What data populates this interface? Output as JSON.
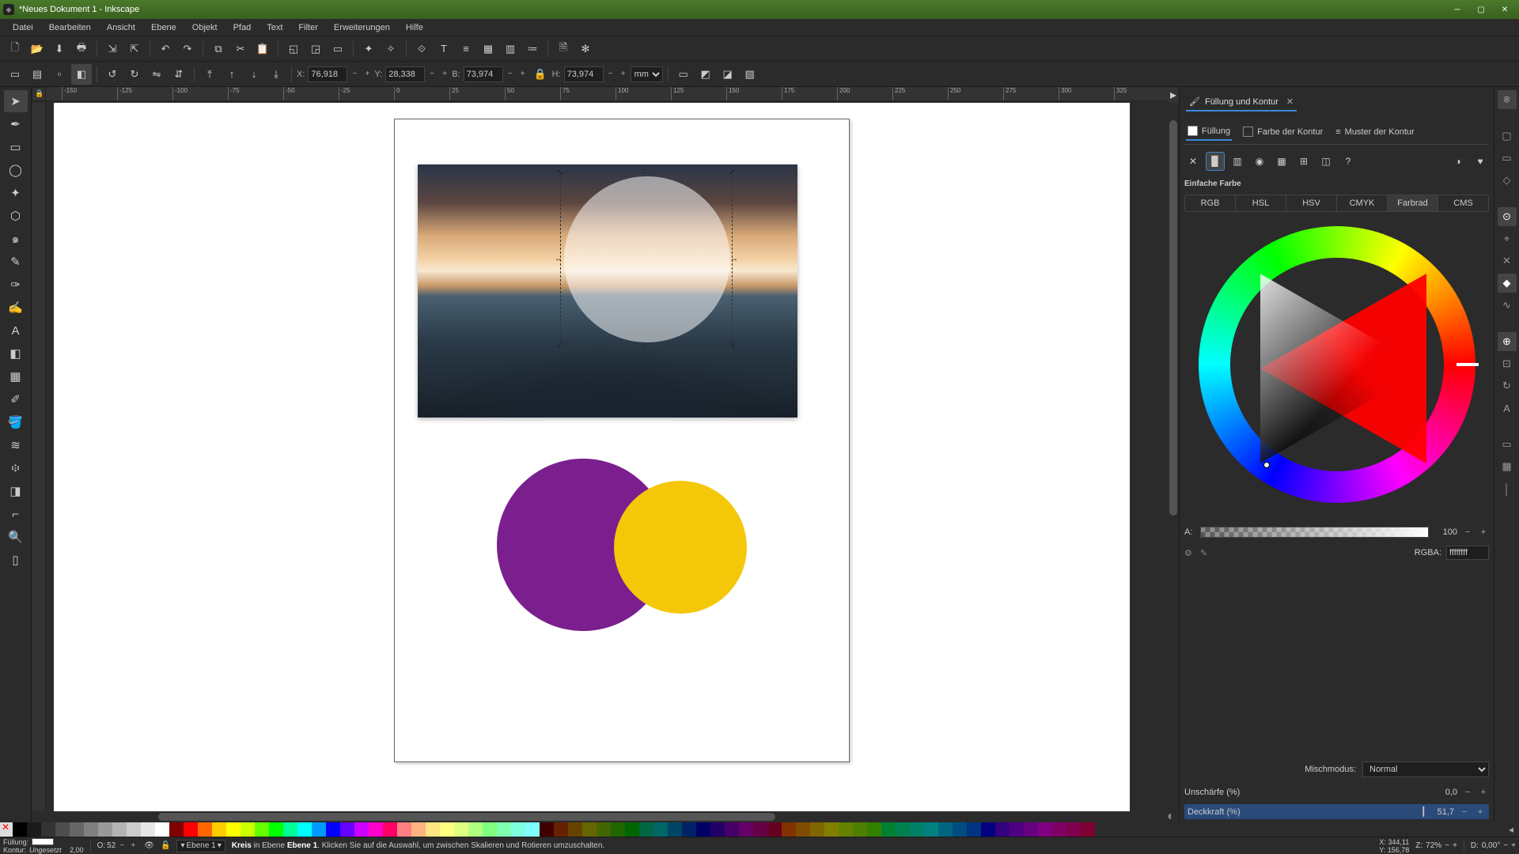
{
  "window": {
    "title": "*Neues Dokument 1 - Inkscape"
  },
  "menu": [
    "Datei",
    "Bearbeiten",
    "Ansicht",
    "Ebene",
    "Objekt",
    "Pfad",
    "Text",
    "Filter",
    "Erweiterungen",
    "Hilfe"
  ],
  "toolbar2": {
    "X_label": "X:",
    "X": "76,918",
    "Y_label": "Y:",
    "Y": "28,338",
    "B_label": "B:",
    "B": "73,974",
    "H_label": "H:",
    "H": "73,974",
    "units": "mm"
  },
  "ruler_ticks": [
    "-150",
    "-125",
    "-100",
    "-75",
    "-50",
    "-25",
    "0",
    "25",
    "50",
    "75",
    "100",
    "125",
    "150",
    "175",
    "200",
    "225",
    "250",
    "275",
    "300",
    "325"
  ],
  "panel": {
    "title": "Füllung und Kontur",
    "tabs": {
      "fill": "Füllung",
      "stroke_paint": "Farbe der Kontur",
      "stroke_style": "Muster der Kontur"
    },
    "flat_color_label": "Einfache Farbe",
    "color_modes": [
      "RGB",
      "HSL",
      "HSV",
      "CMYK",
      "Farbrad",
      "CMS"
    ],
    "alpha_label": "A:",
    "alpha_value": "100",
    "rgba_label": "RGBA:",
    "rgba_value": "ffffffff",
    "blend_label": "Mischmodus:",
    "blend_value": "Normal",
    "blur_label": "Unschärfe (%)",
    "blur_value": "0,0",
    "opacity_label": "Deckkraft (%)",
    "opacity_value": "51,7"
  },
  "status": {
    "fill_label": "Füllung:",
    "stroke_label": "Kontur:",
    "stroke_value": "Ungesetzt",
    "stroke_width": "2,00",
    "o_label": "O:",
    "o_value": "52",
    "layer_label": "Ebene 1",
    "object_type": "Kreis",
    "msg_prefix": "in Ebene",
    "msg_layer": "Ebene 1",
    "msg_rest": ". Klicken Sie auf die Auswahl, um zwischen Skalieren und Rotieren umzuschalten.",
    "X_label": "X:",
    "X": "344,11",
    "Y_label": "Y:",
    "Y": "156,78",
    "Z_label": "Z:",
    "Z": "72%",
    "D_label": "D:",
    "D": "0,00°"
  },
  "palette_colors": [
    "#000000",
    "#1a1a1a",
    "#333333",
    "#4d4d4d",
    "#666666",
    "#808080",
    "#999999",
    "#b3b3b3",
    "#cccccc",
    "#e6e6e6",
    "#ffffff",
    "#800000",
    "#ff0000",
    "#ff6600",
    "#ffcc00",
    "#ffff00",
    "#ccff00",
    "#66ff00",
    "#00ff00",
    "#00ff99",
    "#00ffff",
    "#0099ff",
    "#0000ff",
    "#6600ff",
    "#cc00ff",
    "#ff00cc",
    "#ff0066",
    "#ff8080",
    "#ffb380",
    "#ffe680",
    "#ffff80",
    "#e0ff80",
    "#b0ff80",
    "#80ff80",
    "#80ffb0",
    "#80ffe0",
    "#80ffff",
    "#400000",
    "#662200",
    "#664400",
    "#666600",
    "#446600",
    "#226600",
    "#006600",
    "#006644",
    "#006666",
    "#004466",
    "#002266",
    "#000066",
    "#220066",
    "#440066",
    "#660066",
    "#660044",
    "#660022",
    "#803300",
    "#804d00",
    "#806600",
    "#808000",
    "#668000",
    "#4d8000",
    "#338000",
    "#008033",
    "#00804d",
    "#008066",
    "#008080",
    "#006680",
    "#004d80",
    "#003380",
    "#000080",
    "#330080",
    "#4d0080",
    "#660080",
    "#800080",
    "#800066",
    "#80004d",
    "#800033"
  ],
  "chart_data": null
}
